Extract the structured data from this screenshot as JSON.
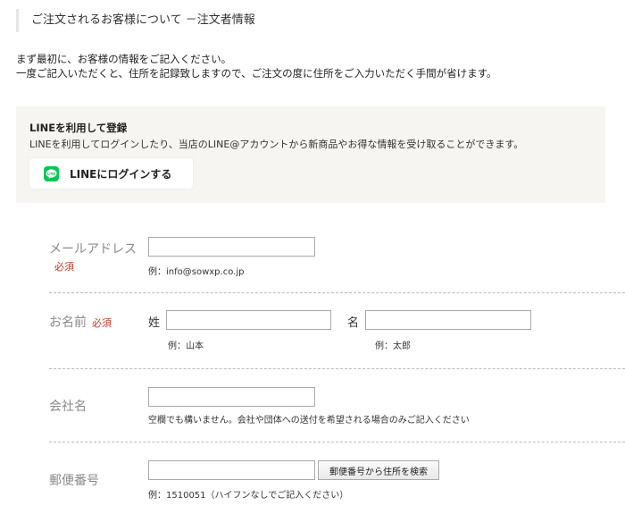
{
  "page": {
    "heading": "ご注文されるお客様について －注文者情報",
    "intro_line1": "まず最初に、お客様の情報をご記入ください。",
    "intro_line2": "一度ご記入いただくと、住所を記録致しますので、ご注文の度に住所をご入力いただく手間が省けます。"
  },
  "line": {
    "title": "LINEを利用して登録",
    "description": "LINEを利用してログインしたり、当店のLINE@アカウントから新商品やお得な情報を受け取ることができます。",
    "button_label": "LINEにログインする",
    "icon_text": "LINE",
    "brand_color": "#06c755"
  },
  "form": {
    "required_label": "必須",
    "email": {
      "label": "メールアドレス",
      "value": "",
      "hint": "例：info@sowxp.co.jp"
    },
    "name": {
      "label": "お名前",
      "last_label": "姓",
      "last_value": "",
      "last_hint": "例：山本",
      "first_label": "名",
      "first_value": "",
      "first_hint": "例：太郎"
    },
    "company": {
      "label": "会社名",
      "value": "",
      "hint": "空欄でも構いません。会社や団体への送付を希望される場合のみご記入ください"
    },
    "postal": {
      "label": "郵便番号",
      "value": "",
      "button": "郵便番号から住所を検索",
      "hint": "例：1510051（ハイフンなしでご記入ください）"
    }
  }
}
